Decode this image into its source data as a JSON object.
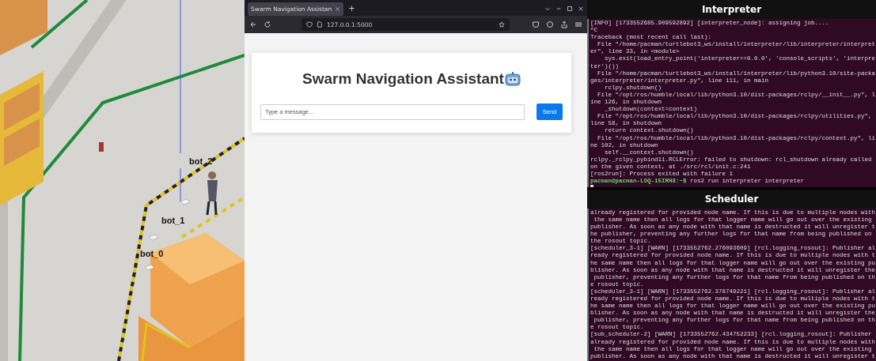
{
  "simulation": {
    "robot_labels": [
      {
        "text": "bot_2"
      },
      {
        "text": "bot_1"
      },
      {
        "text": "bot_0"
      }
    ]
  },
  "browser": {
    "tabs": [
      {
        "title": "Swarm Navigation Assistan",
        "selected": true
      }
    ],
    "new_tab": "+",
    "url": "127.0.0.1:5000",
    "page": {
      "heading": "Swarm Navigation Assistant",
      "input": {
        "placeholder": "Type a message..."
      },
      "send_button": "Send"
    }
  },
  "terminals": [
    {
      "title": "Interpreter",
      "lines": [
        "[INFO] [1733552685.909592892] [interpreter_node]: assigning job....",
        "^C",
        "Traceback (most recent call last):",
        "  File \"/home/pacman/turtlebot3_ws/install/interpreter/lib/interpreter/interpret",
        "er\", line 33, in <module>",
        "    sys.exit(load_entry_point('interpreter==0.0.0', 'console_scripts', 'interpre",
        "ter')())",
        "  File \"/home/pacman/turtlebot3_ws/install/interpreter/lib/python3.10/site-packa",
        "ges/interpreter/interpreter.py\", line 111, in main",
        "    rclpy.shutdown()",
        "  File \"/opt/ros/humble/local/lib/python3.10/dist-packages/rclpy/__init__.py\", l",
        "ine 126, in shutdown",
        "    _shutdown(context=context)",
        "  File \"/opt/ros/humble/local/lib/python3.10/dist-packages/rclpy/utilities.py\",",
        "line 58, in shutdown",
        "    return context.shutdown()",
        "  File \"/opt/ros/humble/local/lib/python3.10/dist-packages/rclpy/context.py\", li",
        "ne 102, in shutdown",
        "    self.__context.shutdown()",
        "rclpy._rclpy_pybind11.RCLError: failed to shutdown: rcl_shutdown already called",
        "on the given context, at ./src/rcl/init.c:241",
        "[ros2run]: Process exited with failure 1"
      ],
      "prompt": {
        "user": "pacman@pacman-LOQ-15IRH8:~$",
        "command": "ros2 run interpreter interpreter"
      }
    },
    {
      "title": "Scheduler",
      "lines": [
        "already registered for provided node name. If this is due to multiple nodes with",
        " the same name then all logs for that logger name will go out over the existing",
        "publisher. As soon as any node with that name is destructed it will unregister t",
        "he publisher, preventing any further logs for that name from being published on",
        "the rosout topic.",
        "[scheduler_3-1] [WARN] [1733552762.276093609] [rcl.logging_rosout]: Publisher al",
        "ready registered for provided node name. If this is due to multiple nodes with t",
        "he same name then all logs for that logger name will go out over the existing pu",
        "blisher. As soon as any node with that name is destructed it will unregister the",
        " publisher, preventing any further logs for that name from being published on th",
        "e rosout topic.",
        "[scheduler_3-1] [WARN] [1733552762.378749221] [rcl.logging_rosout]: Publisher al",
        "ready registered for provided node name. If this is due to multiple nodes with t",
        "he same name then all logs for that logger name will go out over the existing pu",
        "blisher. As soon as any node with that name is destructed it will unregister the",
        " publisher, preventing any further logs for that name from being published on th",
        "e rosout topic.",
        "[sub_scheduler-2] [WARN] [1733552762.434752233] [rcl.logging_rosout]: Publisher",
        "already registered for provided node name. If this is due to multiple nodes with",
        " the same name then all logs for that logger name will go out over the existing",
        "publisher. As soon as any node with that name is destructed it will unregister t"
      ]
    }
  ]
}
